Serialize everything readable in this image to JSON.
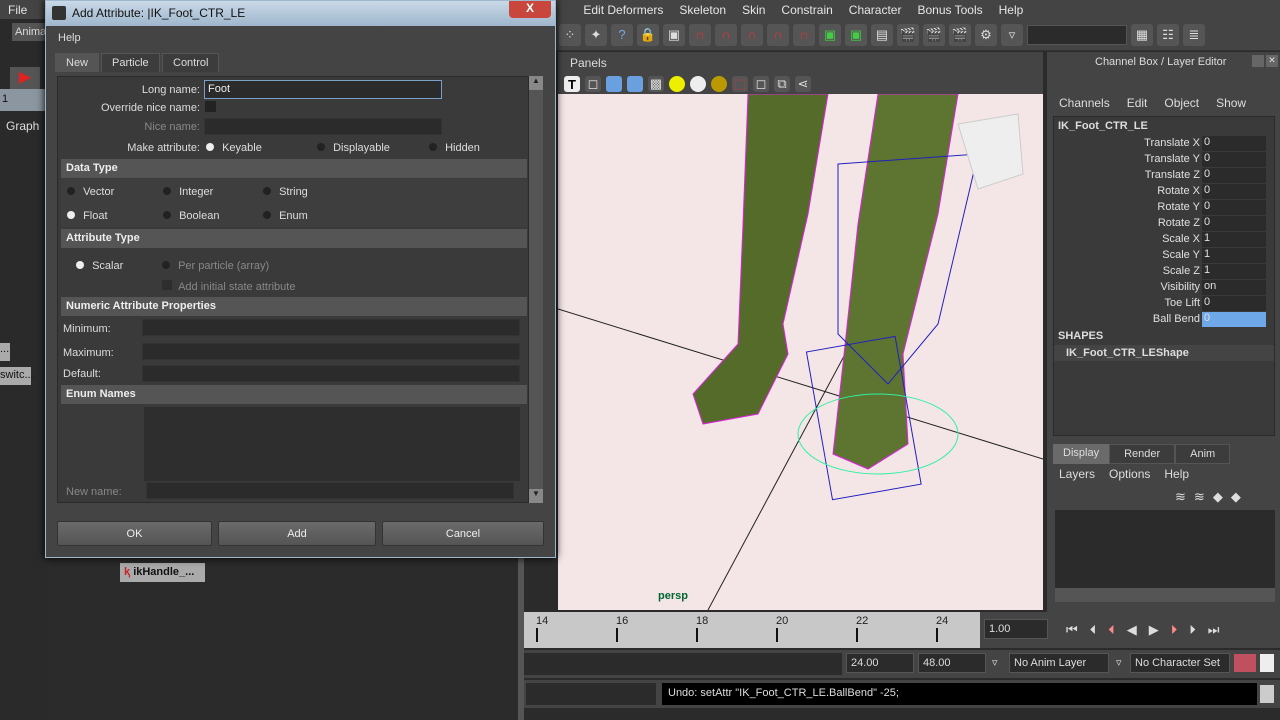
{
  "menubar": {
    "items": [
      "File",
      "Edit Deformers",
      "Skeleton",
      "Skin",
      "Constrain",
      "Character",
      "Bonus Tools",
      "Help"
    ]
  },
  "left": {
    "shelf_tab": "Anima",
    "graph": "Graph",
    "row_num": "1",
    "node1": "...",
    "node2": "switc...",
    "node3": "ikHandle_..."
  },
  "panels": {
    "menu": "Panels",
    "camera": "persp"
  },
  "dialog": {
    "title": "Add Attribute: |IK_Foot_CTR_LE",
    "menu": "Help",
    "tabs": [
      "New",
      "Particle",
      "Control"
    ],
    "long_name_label": "Long name:",
    "long_name_value": "Foot",
    "override_label": "Override nice name:",
    "nice_name_label": "Nice name:",
    "make_attr_label": "Make attribute:",
    "make_attr_options": [
      "Keyable",
      "Displayable",
      "Hidden"
    ],
    "make_attr_selected": "Keyable",
    "data_type_title": "Data Type",
    "data_types": [
      "Vector",
      "Integer",
      "String",
      "Float",
      "Boolean",
      "Enum"
    ],
    "data_type_selected": "Float",
    "attr_type_title": "Attribute Type",
    "scalar": "Scalar",
    "per_particle": "Per particle (array)",
    "add_initial": "Add initial state attribute",
    "numeric_title": "Numeric Attribute Properties",
    "minimum": "Minimum:",
    "maximum": "Maximum:",
    "default": "Default:",
    "enum_title": "Enum Names",
    "new_name": "New name:",
    "ok": "OK",
    "add": "Add",
    "cancel": "Cancel",
    "close": "X"
  },
  "channel_box": {
    "title": "Channel Box / Layer Editor",
    "menu": [
      "Channels",
      "Edit",
      "Object",
      "Show"
    ],
    "object": "IK_Foot_CTR_LE",
    "channels": [
      {
        "name": "Translate X",
        "value": "0"
      },
      {
        "name": "Translate Y",
        "value": "0"
      },
      {
        "name": "Translate Z",
        "value": "0"
      },
      {
        "name": "Rotate X",
        "value": "0"
      },
      {
        "name": "Rotate Y",
        "value": "0"
      },
      {
        "name": "Rotate Z",
        "value": "0"
      },
      {
        "name": "Scale X",
        "value": "1"
      },
      {
        "name": "Scale Y",
        "value": "1"
      },
      {
        "name": "Scale Z",
        "value": "1"
      },
      {
        "name": "Visibility",
        "value": "on"
      },
      {
        "name": "Toe Lift",
        "value": "0"
      },
      {
        "name": "Ball Bend",
        "value": "0"
      }
    ],
    "selected_channel": "Ball Bend",
    "shapes_title": "SHAPES",
    "shape": "IK_Foot_CTR_LEShape"
  },
  "layer_editor": {
    "tabs": [
      "Display",
      "Render",
      "Anim"
    ],
    "menu": [
      "Layers",
      "Options",
      "Help"
    ]
  },
  "timeline": {
    "ticks": [
      "14",
      "16",
      "18",
      "20",
      "22",
      "24"
    ],
    "current_time": "1.00"
  },
  "range": {
    "end": "24.00",
    "max": "48.00",
    "anim_layer": "No Anim Layer",
    "char_set": "No Character Set"
  },
  "command": {
    "output": "Undo: setAttr \"IK_Foot_CTR_LE.BallBend\" -25;"
  },
  "colors": {
    "accent_select": "#6fa8e8",
    "wire": "#e020e0",
    "ik": "#30f0a0",
    "viewport_bg": "#f4e6e6"
  }
}
